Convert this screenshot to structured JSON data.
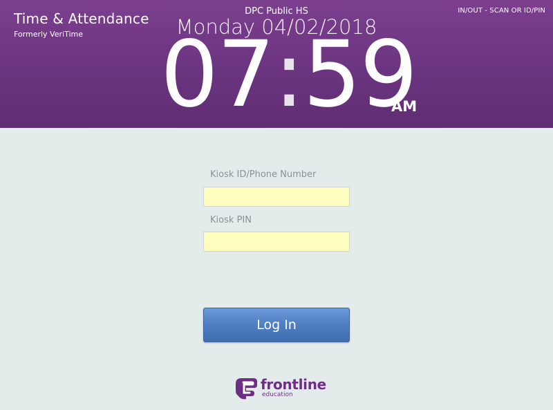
{
  "header": {
    "app_title": "Time & Attendance",
    "app_subtitle": "Formerly VeriTime",
    "mode_label": "IN/OUT - SCAN OR ID/PIN",
    "school_name": "DPC Public HS",
    "date": "Monday 04/02/2018",
    "time_hours": "07",
    "time_separator": ":",
    "time_minutes": "59",
    "ampm": "AM"
  },
  "form": {
    "kiosk_id_label": "Kiosk ID/Phone Number",
    "kiosk_id_value": "",
    "kiosk_pin_label": "Kiosk PIN",
    "kiosk_pin_value": "",
    "login_label": "Log In"
  },
  "footer": {
    "logo_word": "frontline",
    "logo_sub": "education",
    "logo_icon": "frontline-logo-icon"
  },
  "colors": {
    "header_purple": "#6b3480",
    "page_background": "#e4ebeb",
    "input_background": "#fcfdbe",
    "button_blue": "#4f7fc2",
    "logo_purple": "#6d2f86"
  }
}
